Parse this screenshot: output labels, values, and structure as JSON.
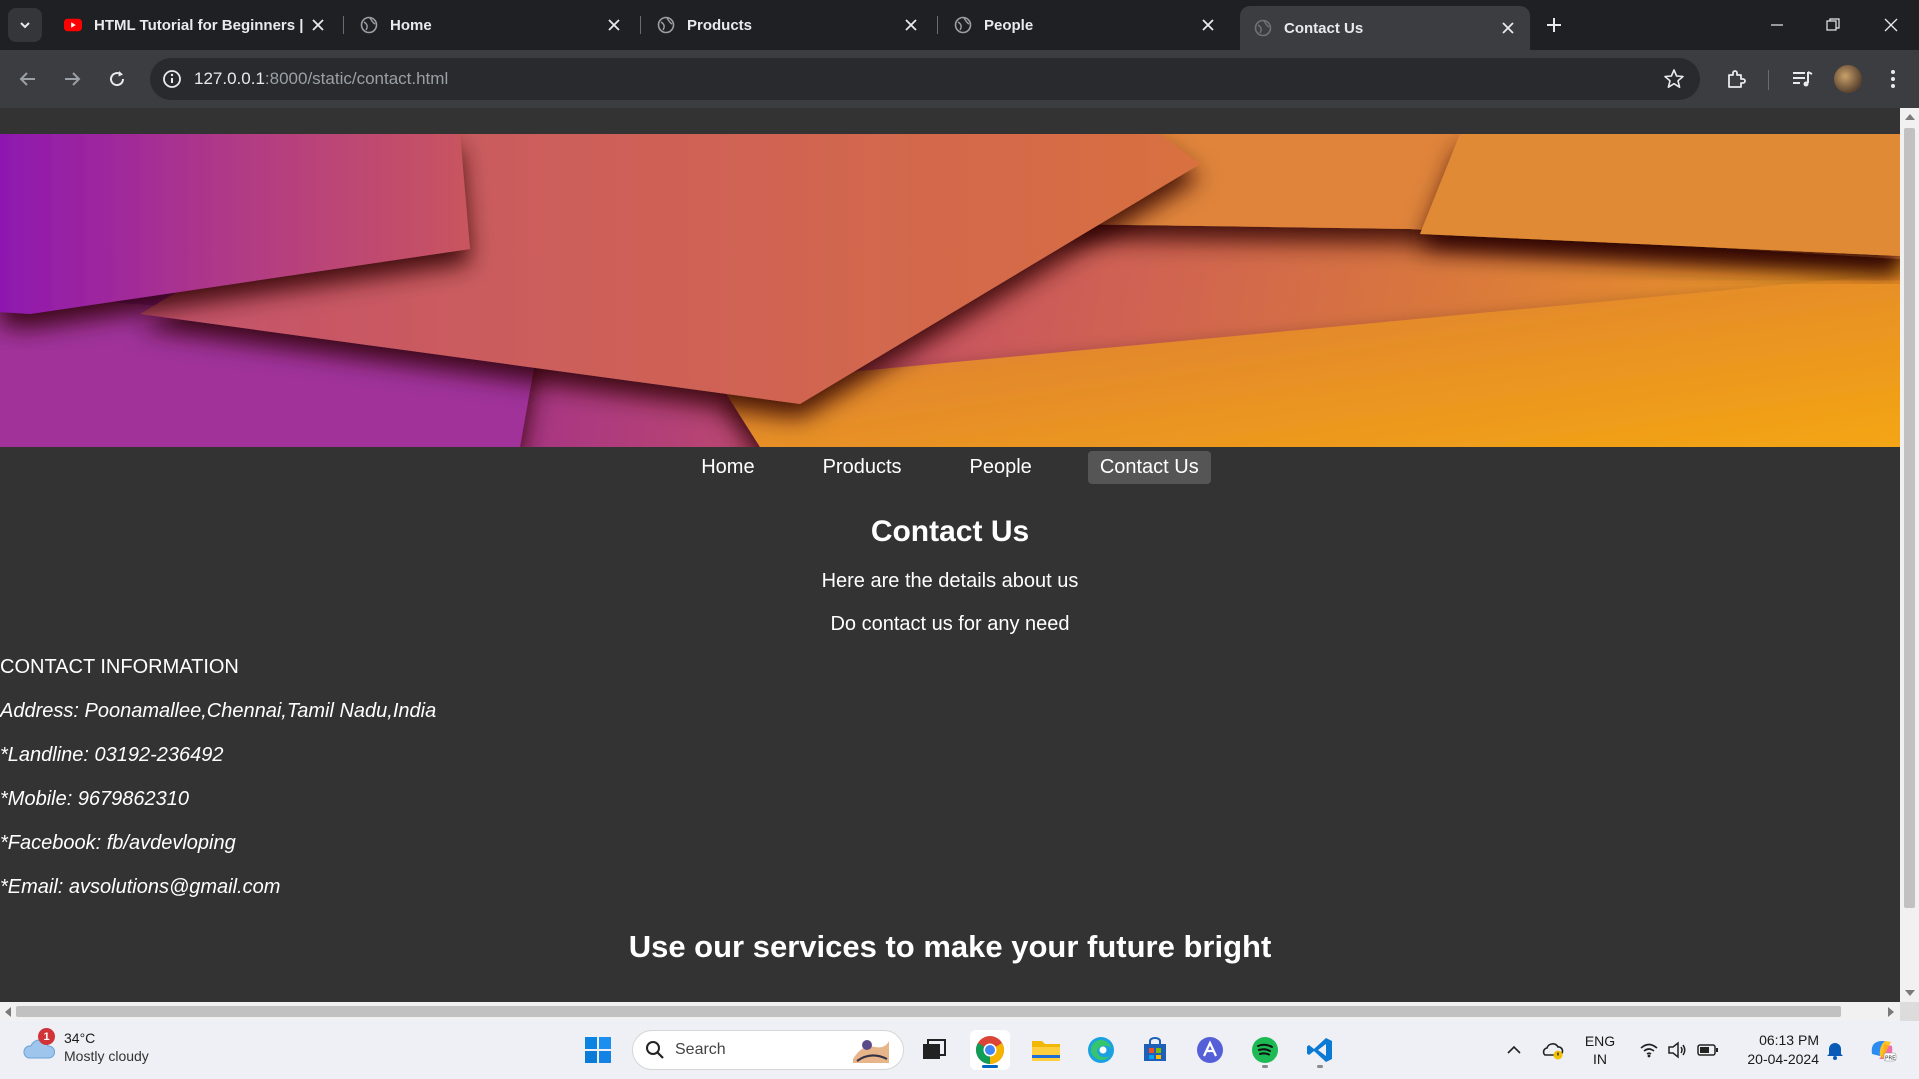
{
  "browser": {
    "tabs": [
      {
        "title": "HTML Tutorial for Beginners | C",
        "favicon": "youtube-icon",
        "active": false
      },
      {
        "title": "Home",
        "favicon": "globe-icon",
        "active": false
      },
      {
        "title": "Products",
        "favicon": "globe-icon",
        "active": false
      },
      {
        "title": "People",
        "favicon": "globe-icon",
        "active": false
      },
      {
        "title": "Contact Us",
        "favicon": "globe-icon",
        "active": true
      }
    ],
    "url_host": "127.0.0.1",
    "url_rest": ":8000/static/contact.html"
  },
  "page": {
    "nav": [
      "Home",
      "Products",
      "People",
      "Contact Us"
    ],
    "active_nav": "Contact Us",
    "heading": "Contact Us",
    "intro_1": "Here are the details about us",
    "intro_2": "Do contact us for any need",
    "contact_title": "CONTACT INFORMATION",
    "contact_lines": [
      "Address: Poonamallee,Chennai,Tamil Nadu,India",
      "*Landline: 03192-236492",
      "*Mobile: 9679862310",
      "*Facebook: fb/avdevloping",
      "*Email: avsolutions@gmail.com"
    ],
    "tagline": "Use our services to make your future bright",
    "colors": {
      "background": "#333333",
      "active_nav_bg": "#555555",
      "text": "#ffffff"
    }
  },
  "taskbar": {
    "weather_temp": "34°C",
    "weather_cond": "Mostly cloudy",
    "weather_badge": "1",
    "search_label": "Search",
    "lang_1": "ENG",
    "lang_2": "IN",
    "time": "06:13 PM",
    "date": "20-04-2024"
  }
}
